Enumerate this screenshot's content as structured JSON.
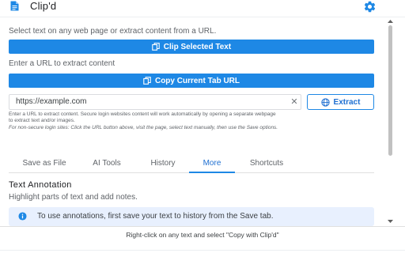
{
  "app": {
    "title": "Clip'd",
    "accent_color": "#1e88e5",
    "header_icon": "document-icon",
    "settings_icon": "gear-icon"
  },
  "clip": {
    "intro": "Select text on any web page or extract content from a URL.",
    "clip_button_label": "Clip Selected Text",
    "clip_button_icon": "copy-icon"
  },
  "extract": {
    "prompt": "Enter a URL to extract content",
    "copy_tab_label": "Copy Current Tab URL",
    "copy_tab_icon": "copy-icon",
    "url_value": "https://example.com",
    "clear_icon": "close-icon",
    "extract_label": "Extract",
    "extract_icon": "globe-icon",
    "help_line1": "Enter a URL to extract content. Secure login websites content will work automatically by opening a separate webpage",
    "help_line2": "to extract text and/or images.",
    "help_line3": "For non-secure login sites: Click the URL button above, visit the page, select text manually, then use the Save options."
  },
  "tabs": [
    {
      "label": "Save as File",
      "active": false
    },
    {
      "label": "AI Tools",
      "active": false
    },
    {
      "label": "History",
      "active": false
    },
    {
      "label": "More",
      "active": true
    },
    {
      "label": "Shortcuts",
      "active": false
    }
  ],
  "more": {
    "title": "Text Annotation",
    "subtitle": "Highlight parts of text and add notes.",
    "info_icon": "info-icon",
    "info_text": "To use annotations, first save your text to history from the Save tab."
  },
  "footer": {
    "text": "Right-click on any text and select \"Copy with Clip'd\""
  }
}
